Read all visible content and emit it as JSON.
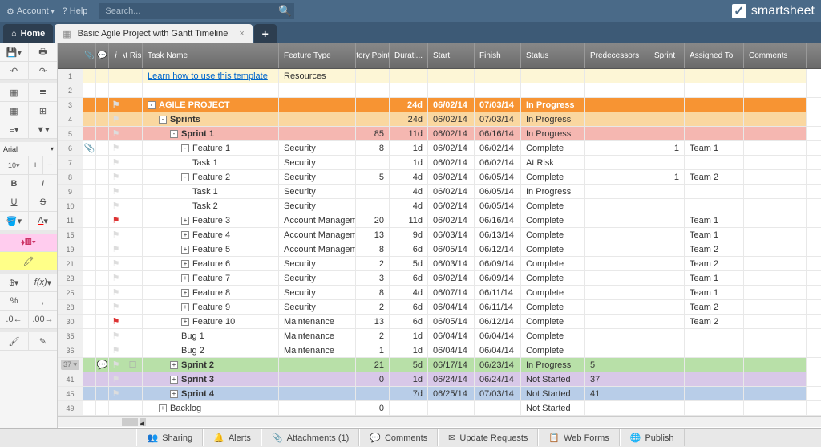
{
  "topbar": {
    "account": "Account",
    "help": "Help",
    "search_ph": "Search..."
  },
  "logo": "smartsheet",
  "tabs": {
    "home": "Home",
    "sheet": "Basic Agile Project with Gantt Timeline"
  },
  "toolbar": {
    "font": "Arial",
    "size": "10"
  },
  "columns": {
    "risk": "At Risk",
    "task": "Task Name",
    "ftype": "Feature Type",
    "story": "Story Points",
    "dur": "Durati...",
    "start": "Start",
    "finish": "Finish",
    "status": "Status",
    "pred": "Predecessors",
    "sprint": "Sprint",
    "assign": "Assigned To",
    "comm": "Comments"
  },
  "rows": [
    {
      "n": 1,
      "cls": "r-top",
      "task": "Learn how to use this template",
      "link": true,
      "ftype": "Resources",
      "indent": 0
    },
    {
      "n": 2
    },
    {
      "n": 3,
      "cls": "r-orange",
      "flag": "gray",
      "exp": "-",
      "task": "AGILE PROJECT",
      "bold": true,
      "dur": "24d",
      "start": "06/02/14",
      "finish": "07/03/14",
      "status": "In Progress",
      "indent": 0
    },
    {
      "n": 4,
      "cls": "r-ltorange",
      "flag": "gray",
      "exp": "-",
      "task": "Sprints",
      "bold": true,
      "dur": "24d",
      "start": "06/02/14",
      "finish": "07/03/14",
      "status": "In Progress",
      "indent": 1
    },
    {
      "n": 5,
      "cls": "r-pink",
      "flag": "gray",
      "exp": "-",
      "task": "Sprint 1",
      "bold": true,
      "story": "85",
      "dur": "11d",
      "start": "06/02/14",
      "finish": "06/16/14",
      "status": "In Progress",
      "indent": 2
    },
    {
      "n": 6,
      "attach": true,
      "flag": "gray",
      "exp": "-",
      "task": "Feature 1",
      "ftype": "Security",
      "story": "8",
      "dur": "1d",
      "start": "06/02/14",
      "finish": "06/02/14",
      "status": "Complete",
      "sprint": "1",
      "assign": "Team 1",
      "indent": 3
    },
    {
      "n": 7,
      "flag": "gray",
      "task": "Task 1",
      "ftype": "Security",
      "dur": "1d",
      "start": "06/02/14",
      "finish": "06/02/14",
      "status": "At Risk",
      "indent": 4
    },
    {
      "n": 8,
      "flag": "gray",
      "exp": "-",
      "task": "Feature 2",
      "ftype": "Security",
      "story": "5",
      "dur": "4d",
      "start": "06/02/14",
      "finish": "06/05/14",
      "status": "Complete",
      "sprint": "1",
      "assign": "Team 2",
      "indent": 3
    },
    {
      "n": 9,
      "flag": "gray",
      "task": "Task 1",
      "ftype": "Security",
      "dur": "4d",
      "start": "06/02/14",
      "finish": "06/05/14",
      "status": "In Progress",
      "indent": 4
    },
    {
      "n": 10,
      "flag": "gray",
      "task": "Task 2",
      "ftype": "Security",
      "dur": "4d",
      "start": "06/02/14",
      "finish": "06/05/14",
      "status": "Complete",
      "indent": 4
    },
    {
      "n": 11,
      "flag": "red",
      "exp": "+",
      "task": "Feature 3",
      "ftype": "Account Managemen",
      "story": "20",
      "dur": "11d",
      "start": "06/02/14",
      "finish": "06/16/14",
      "status": "Complete",
      "assign": "Team 1",
      "indent": 3
    },
    {
      "n": 15,
      "flag": "gray",
      "exp": "+",
      "task": "Feature 4",
      "ftype": "Account Managemen",
      "story": "13",
      "dur": "9d",
      "start": "06/03/14",
      "finish": "06/13/14",
      "status": "Complete",
      "assign": "Team 1",
      "indent": 3
    },
    {
      "n": 19,
      "flag": "gray",
      "exp": "+",
      "task": "Feature 5",
      "ftype": "Account Managemen",
      "story": "8",
      "dur": "6d",
      "start": "06/05/14",
      "finish": "06/12/14",
      "status": "Complete",
      "assign": "Team 2",
      "indent": 3
    },
    {
      "n": 21,
      "flag": "gray",
      "exp": "+",
      "task": "Feature 6",
      "ftype": "Security",
      "story": "2",
      "dur": "5d",
      "start": "06/03/14",
      "finish": "06/09/14",
      "status": "Complete",
      "assign": "Team 2",
      "indent": 3
    },
    {
      "n": 23,
      "flag": "gray",
      "exp": "+",
      "task": "Feature 7",
      "ftype": "Security",
      "story": "3",
      "dur": "6d",
      "start": "06/02/14",
      "finish": "06/09/14",
      "status": "Complete",
      "assign": "Team 1",
      "indent": 3
    },
    {
      "n": 25,
      "flag": "gray",
      "exp": "+",
      "task": "Feature 8",
      "ftype": "Security",
      "story": "8",
      "dur": "4d",
      "start": "06/07/14",
      "finish": "06/11/14",
      "status": "Complete",
      "assign": "Team 1",
      "indent": 3
    },
    {
      "n": 28,
      "flag": "gray",
      "exp": "+",
      "task": "Feature 9",
      "ftype": "Security",
      "story": "2",
      "dur": "6d",
      "start": "06/04/14",
      "finish": "06/11/14",
      "status": "Complete",
      "assign": "Team 2",
      "indent": 3
    },
    {
      "n": 30,
      "flag": "red",
      "exp": "+",
      "task": "Feature 10",
      "ftype": "Maintenance",
      "story": "13",
      "dur": "6d",
      "start": "06/05/14",
      "finish": "06/12/14",
      "status": "Complete",
      "assign": "Team 2",
      "indent": 3
    },
    {
      "n": 35,
      "flag": "gray",
      "task": "Bug 1",
      "ftype": "Maintenance",
      "story": "2",
      "dur": "1d",
      "start": "06/04/14",
      "finish": "06/04/14",
      "status": "Complete",
      "indent": 3
    },
    {
      "n": 36,
      "flag": "gray",
      "task": "Bug 2",
      "ftype": "Maintenance",
      "story": "1",
      "dur": "1d",
      "start": "06/04/14",
      "finish": "06/04/14",
      "status": "Complete",
      "indent": 3
    },
    {
      "n": 37,
      "cls": "r-green",
      "flag": "gray",
      "exp": "+",
      "task": "Sprint 2",
      "bold": true,
      "story": "21",
      "dur": "5d",
      "start": "06/17/14",
      "finish": "06/23/14",
      "status": "In Progress",
      "pred": "5",
      "indent": 2,
      "sel": true
    },
    {
      "n": 41,
      "cls": "r-purple",
      "flag": "gray",
      "exp": "+",
      "task": "Sprint 3",
      "bold": true,
      "story": "0",
      "dur": "1d",
      "start": "06/24/14",
      "finish": "06/24/14",
      "status": "Not Started",
      "pred": "37",
      "indent": 2
    },
    {
      "n": 45,
      "cls": "r-blue",
      "flag": "gray",
      "exp": "+",
      "task": "Sprint 4",
      "bold": true,
      "dur": "7d",
      "start": "06/25/14",
      "finish": "07/03/14",
      "status": "Not Started",
      "pred": "41",
      "indent": 2
    },
    {
      "n": 49,
      "exp": "+",
      "task": "Backlog",
      "story": "0",
      "status": "Not Started",
      "indent": 1
    }
  ],
  "footer": {
    "sharing": "Sharing",
    "alerts": "Alerts",
    "attach": "Attachments (1)",
    "comments": "Comments",
    "update": "Update Requests",
    "forms": "Web Forms",
    "publish": "Publish"
  }
}
